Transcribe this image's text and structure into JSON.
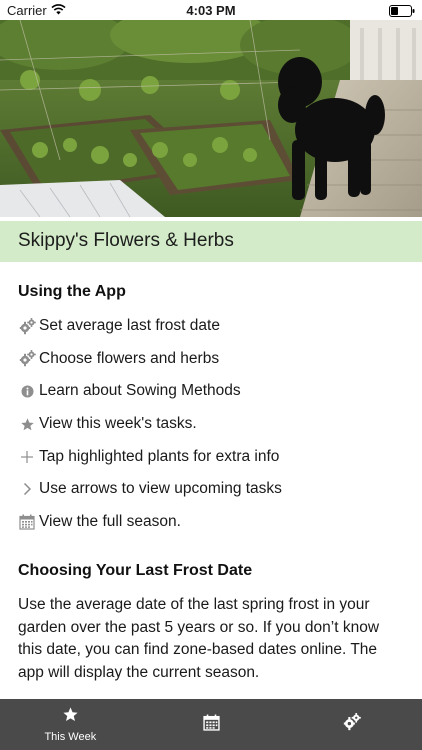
{
  "status_bar": {
    "carrier": "Carrier",
    "time": "4:03 PM",
    "icons": [
      "wifi-icon",
      "battery-icon"
    ]
  },
  "hero": {
    "icon": "garden-photo"
  },
  "title": "Skippy's Flowers & Herbs",
  "using_app": {
    "heading": "Using the App",
    "items": [
      {
        "icon": "gears-icon",
        "label": "Set average last frost date"
      },
      {
        "icon": "gears-icon",
        "label": "Choose flowers and herbs"
      },
      {
        "icon": "info-icon",
        "label": "Learn about Sowing Methods"
      },
      {
        "icon": "star-icon",
        "label": "View this week's tasks."
      },
      {
        "icon": "plus-icon",
        "label": "Tap highlighted plants for extra info"
      },
      {
        "icon": "chevron-right-icon",
        "label": "Use arrows to view upcoming tasks"
      },
      {
        "icon": "calendar-icon",
        "label": "View the full season."
      }
    ]
  },
  "frost_date": {
    "heading": "Choosing Your Last Frost Date",
    "body": "Use the average date of the last spring frost in your garden over the past 5 years or so. If you don’t know this date, you can find zone-based dates online. The app will display the current season."
  },
  "tab_bar": {
    "tabs": [
      {
        "icon": "star-icon",
        "label": "This Week"
      },
      {
        "icon": "calendar-icon",
        "label": ""
      },
      {
        "icon": "gears-icon",
        "label": ""
      }
    ]
  },
  "colors": {
    "title_band": "#d3ebc8",
    "tab_bar": "#4a4a4a",
    "icon_gray": "#8e8e8e"
  }
}
